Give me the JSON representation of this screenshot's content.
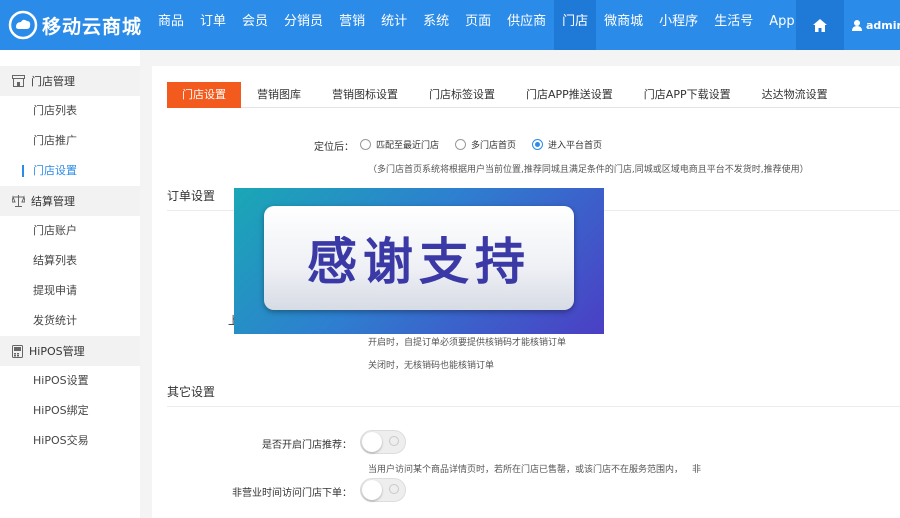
{
  "brand": {
    "name": "移动云商城",
    "logo_icon": "cloud-logo-icon"
  },
  "nav": {
    "items": [
      "商品",
      "订单",
      "会员",
      "分销员",
      "营销",
      "统计",
      "系统",
      "页面",
      "供应商",
      "门店",
      "微商城",
      "小程序",
      "生活号",
      "App"
    ],
    "active": "门店"
  },
  "user": {
    "name": "admin",
    "icon": "user-icon"
  },
  "sidebar": {
    "groups": [
      {
        "title": "门店管理",
        "icon": "store-icon",
        "items": [
          "门店列表",
          "门店推广",
          "门店设置"
        ]
      },
      {
        "title": "结算管理",
        "icon": "scale-icon",
        "items": [
          "门店账户",
          "结算列表",
          "提现申请",
          "发货统计"
        ]
      },
      {
        "title": "HiPOS管理",
        "icon": "pos-icon",
        "items": [
          "HiPOS设置",
          "HiPOS绑定",
          "HiPOS交易"
        ]
      }
    ],
    "active_item": "门店设置"
  },
  "tabs": [
    "门店设置",
    "营销图库",
    "营销图标设置",
    "门店标签设置",
    "门店APP推送设置",
    "门店APP下载设置",
    "达达物流设置"
  ],
  "locate": {
    "label": "定位后：",
    "options": [
      "匹配至最近门店",
      "多门店首页",
      "进入平台首页"
    ],
    "selected": 2,
    "note": "（多门店首页系统将根据用户当前位置,推荐同城且满足条件的门店,同城或区域电商且平台不发货时,推荐使用）"
  },
  "order_section": {
    "title": "订单设置",
    "partial_label": "上",
    "note_on": "开启时，自提订单必须要提供核销码才能核销订单",
    "note_off": "关闭时，无核销码也能核销订单"
  },
  "other_section": {
    "title": "其它设置",
    "recommend_label": "是否开启门店推荐：",
    "recommend_note": "当用户访问某个商品详情页时，若所在门店已售罄，或该门店不在服务范围内，",
    "recommend_note_tail": "非",
    "offhours_label": "非营业时间访问门店下单："
  },
  "overlay": {
    "text": "感谢支持"
  },
  "colors": {
    "primary": "#2b8be8",
    "tab_active": "#f35a1e",
    "overlay_text": "#3a39a6"
  }
}
